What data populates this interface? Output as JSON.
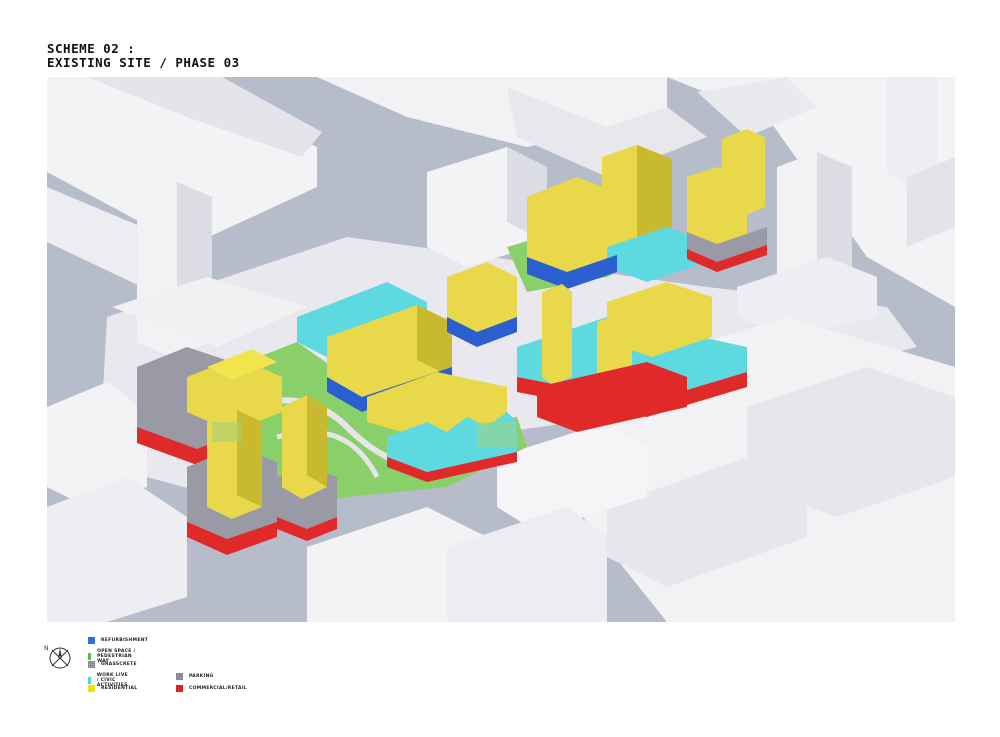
{
  "title": {
    "line1": "SCHEME 02 :",
    "line2": "EXISTING SITE / PHASE 03"
  },
  "compass": {
    "label": "N"
  },
  "legend": [
    {
      "id": "refurbishment",
      "label": "REFURBISHMENT",
      "color": "#2f6fe0"
    },
    {
      "id": "open-space",
      "label": "OPEN SPACE / PEDESTRIAN WAY",
      "color": "#4fc24a"
    },
    {
      "id": "grasscrete",
      "label": "GRASSCRETE",
      "color": "#b8b8b8"
    },
    {
      "id": "work-live",
      "label": "WORK LIVE / CIVIC ACTIVITIES",
      "color": "#4ad6e0"
    },
    {
      "id": "residential",
      "label": "RESIDENTIAL",
      "color": "#f2e200"
    },
    {
      "id": "parking",
      "label": "PARKING",
      "color": "#8c8c96"
    },
    {
      "id": "commercial",
      "label": "COMMERCIAL/RETAIL",
      "color": "#e02020"
    }
  ],
  "colors": {
    "road": "#a9aec0",
    "ground": "#f4f4f6",
    "massing": "#f1f1f4",
    "residential": "#e8d84a",
    "work_live": "#5fd9e0",
    "refurb": "#2a5fcf",
    "open_space": "#7ccc5a",
    "commercial": "#e02a2a",
    "parking": "#9a9aa6"
  }
}
